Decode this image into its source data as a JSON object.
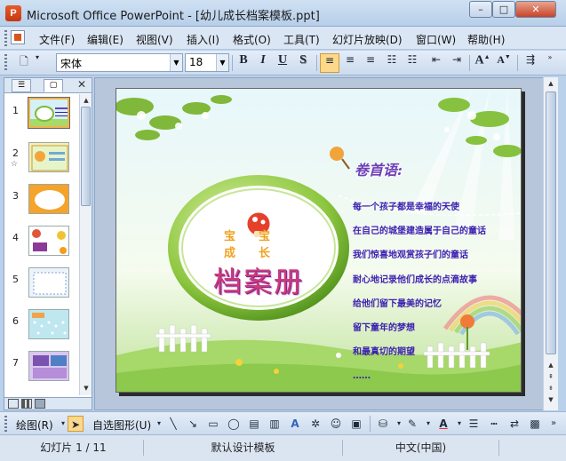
{
  "window": {
    "title": "Microsoft Office PowerPoint - [幼儿成长档案模板.ppt]",
    "min_label": "–",
    "max_label": "□",
    "close_label": "✕"
  },
  "menu": {
    "items": [
      "文件(F)",
      "编辑(E)",
      "视图(V)",
      "插入(I)",
      "格式(O)",
      "工具(T)",
      "幻灯片放映(D)",
      "窗口(W)",
      "帮助(H)"
    ]
  },
  "toolbar": {
    "font_name": "宋体",
    "font_size": "18",
    "bold": "B",
    "italic": "I",
    "underline": "U",
    "shadow": "S"
  },
  "slides_pane": {
    "numbers": [
      "1",
      "2",
      "3",
      "4",
      "5",
      "6",
      "7"
    ],
    "selected": 1
  },
  "slide": {
    "badge_text": "宝宝 成长",
    "main_title": "档案册",
    "heading": "卷首语:",
    "lines": [
      "每一个孩子都是幸福的天使",
      "在自己的城堡建造属于自己的童话",
      "我们惊喜地观赏孩子们的童话",
      "耐心地记录他们成长的点滴故事",
      "给他们留下最美的记忆",
      "留下童年的梦想",
      "和最真切的期望",
      "……"
    ]
  },
  "drawbar": {
    "draw_label": "绘图(R)",
    "autoshape_label": "自选图形(U)"
  },
  "status": {
    "slide_info": "幻灯片 1 / 11",
    "design": "默认设计模板",
    "language": "中文(中国)"
  },
  "colors": {
    "accent": "#fbd88a",
    "title_purple": "#6e3fb6",
    "slide_text": "#3b1fb0"
  }
}
